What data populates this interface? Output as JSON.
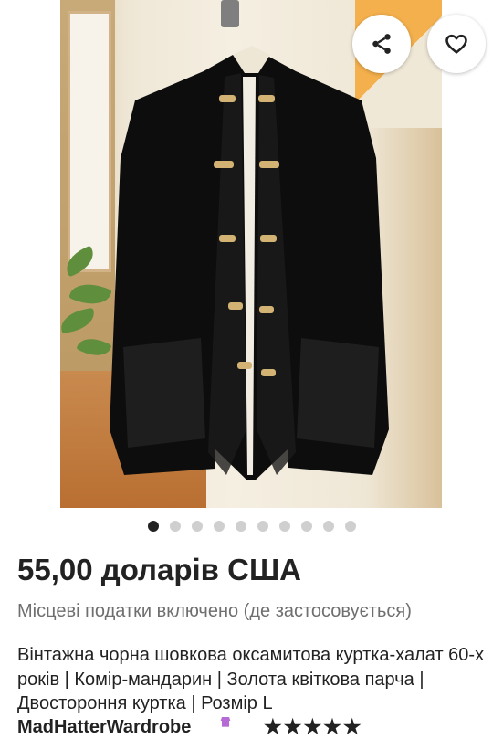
{
  "listing": {
    "image_alt": "Black velvet jacket on mannequin",
    "carousel": {
      "total": 10,
      "active": 1
    },
    "price": "55,00 доларів США",
    "tax_note": "Місцеві податки включено (де застосовується)",
    "title": "Вінтажна чорна шовкова оксамитова куртка-халат 60-х років | Комір-мандарин | Золота квіткова парча | Двостороння куртка | Розмір L",
    "seller_name": "MadHatterWardrobe",
    "stars": "★★★★★"
  },
  "actions": {
    "share_icon": "share-icon",
    "favorite_icon": "heart-icon"
  },
  "colors": {
    "text": "#222222",
    "muted": "#6f6f6f",
    "dot_inactive": "#cfcfcf",
    "dot_active": "#222222"
  }
}
